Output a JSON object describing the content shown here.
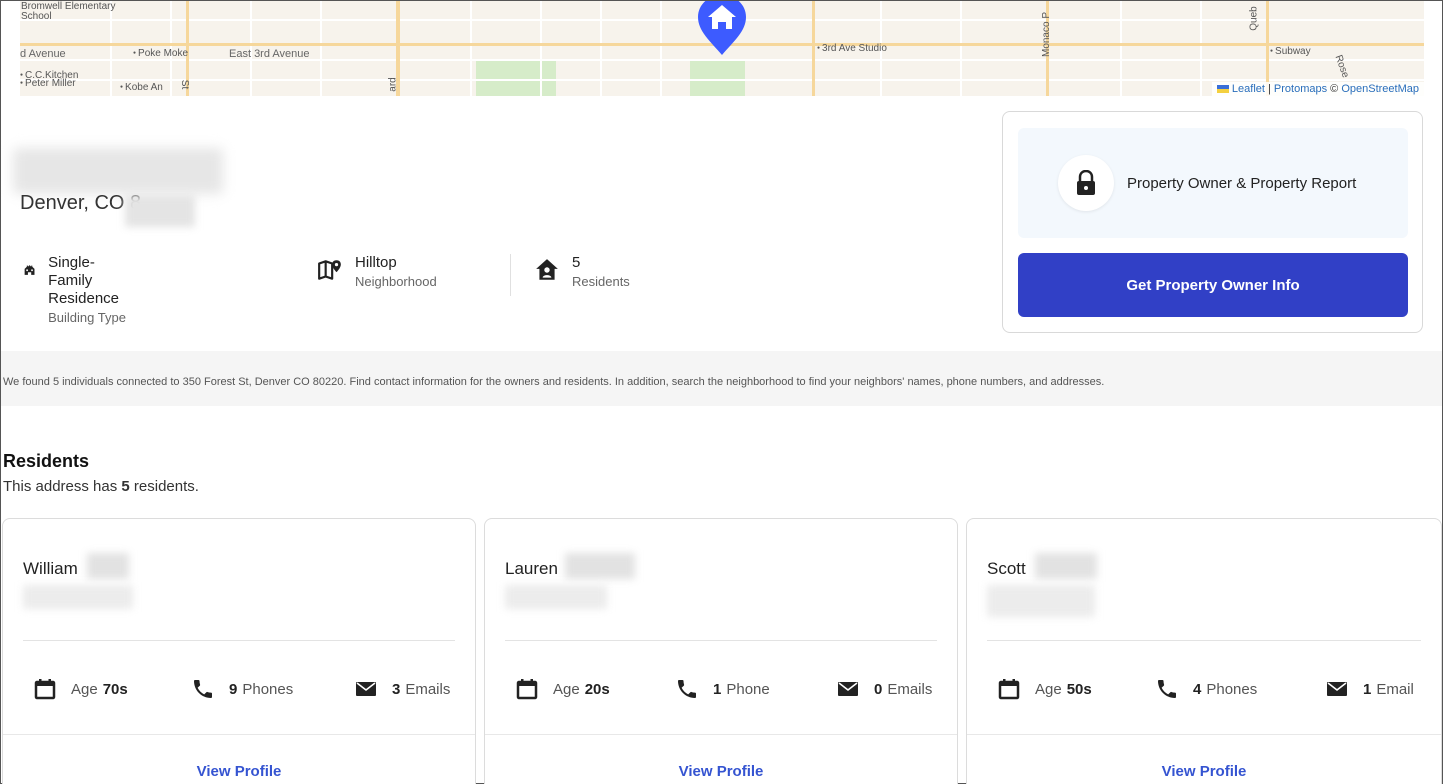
{
  "map": {
    "labels": {
      "school": "Bromwell Elementary\nSchool",
      "avenue_left": "d Avenue",
      "poke_moke": "Poke Moke",
      "east3rd": "East 3rd Avenue",
      "cc_kitchen": "C.C.Kitchen",
      "peter_miller": "Peter Miller",
      "kobe_an": "Kobe An",
      "studio": "3rd Ave Studio",
      "monaco": "Monaco P",
      "subway": "Subway",
      "st": "St",
      "ard": "ard",
      "queb": "Queb",
      "rose": "Rose"
    },
    "attribution": {
      "leaflet": "Leaflet",
      "sep1": " | ",
      "protomaps": "Protomaps",
      "sep2": " © ",
      "osm": "OpenStreetMap"
    },
    "pin_color": "#3d5bff"
  },
  "address": {
    "city_state": "Denver, CO 8"
  },
  "facts": [
    {
      "value": "Single-Family Residence",
      "label": "Building Type"
    },
    {
      "value": "Hilltop",
      "label": "Neighborhood"
    },
    {
      "value": "5",
      "label": "Residents"
    }
  ],
  "side": {
    "report_label": "Property Owner & Property Report",
    "button_label": "Get Property Owner Info",
    "button_color": "#3140c6"
  },
  "notice": "We found 5 individuals connected to 350 Forest St, Denver CO 80220. Find contact information for the owners and residents. In addition, search the neighborhood to find your neighbors' names, phone numbers, and addresses.",
  "residents": {
    "title": "Residents",
    "subtitle_pre": "This address has ",
    "count": "5",
    "subtitle_post": " residents.",
    "cards": [
      {
        "name": "William",
        "age_label": "Age",
        "age": "70s",
        "phones": "9",
        "phones_label": "Phones",
        "emails": "3",
        "emails_label": "Emails",
        "view": "View Profile"
      },
      {
        "name": "Lauren",
        "age_label": "Age",
        "age": "20s",
        "phones": "1",
        "phones_label": "Phone",
        "emails": "0",
        "emails_label": "Emails",
        "view": "View Profile"
      },
      {
        "name": "Scott",
        "age_label": "Age",
        "age": "50s",
        "phones": "4",
        "phones_label": "Phones",
        "emails": "1",
        "emails_label": "Email",
        "view": "View Profile"
      }
    ]
  }
}
